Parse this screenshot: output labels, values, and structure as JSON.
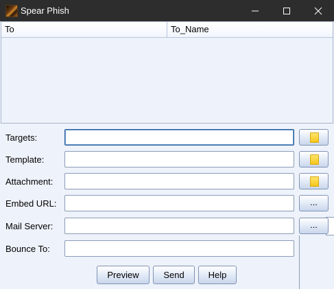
{
  "window": {
    "title": "Spear Phish"
  },
  "table": {
    "columns": [
      "To",
      "To_Name"
    ]
  },
  "form": {
    "targets": {
      "label": "Targets:",
      "value": ""
    },
    "template": {
      "label": "Template:",
      "value": ""
    },
    "attachment": {
      "label": "Attachment:",
      "value": ""
    },
    "embed_url": {
      "label": "Embed URL:",
      "value": "",
      "button": "..."
    },
    "mail_server": {
      "label": "Mail Server:",
      "value": "",
      "button": "..."
    },
    "bounce_to": {
      "label": "Bounce To:",
      "value": ""
    }
  },
  "buttons": {
    "preview": "Preview",
    "send": "Send",
    "help": "Help"
  }
}
